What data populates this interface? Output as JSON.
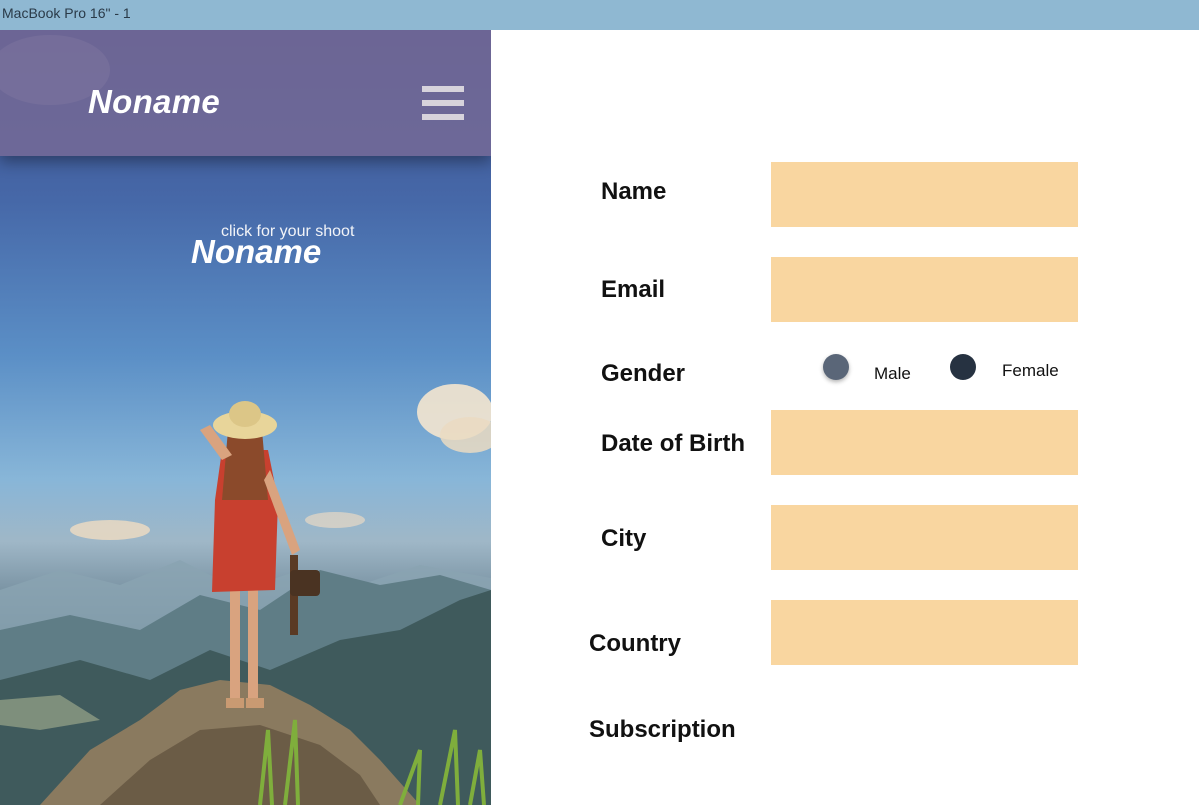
{
  "frame": {
    "label": "MacBook Pro 16\" - 1"
  },
  "navbar": {
    "brand": "Noname",
    "menu_icon": "hamburger-menu-icon"
  },
  "hero": {
    "caption": "click for your shoot",
    "title": "Noname",
    "image": "woman-in-red-dress-on-mountain-photo"
  },
  "form": {
    "name": {
      "label": "Name",
      "value": ""
    },
    "email": {
      "label": "Email",
      "value": ""
    },
    "gender": {
      "label": "Gender",
      "options": [
        {
          "label": "Male",
          "color": "#5a6678"
        },
        {
          "label": "Female",
          "color": "#263241"
        }
      ]
    },
    "dob": {
      "label": "Date of Birth",
      "value": ""
    },
    "city": {
      "label": "City",
      "value": ""
    },
    "country": {
      "label": "Country",
      "value": ""
    },
    "subscription": {
      "label": "Subscription"
    }
  },
  "colors": {
    "frame_bar": "#8fb8d2",
    "input_fill": "#f9d6a0",
    "navbar_overlay": "#766a96"
  }
}
